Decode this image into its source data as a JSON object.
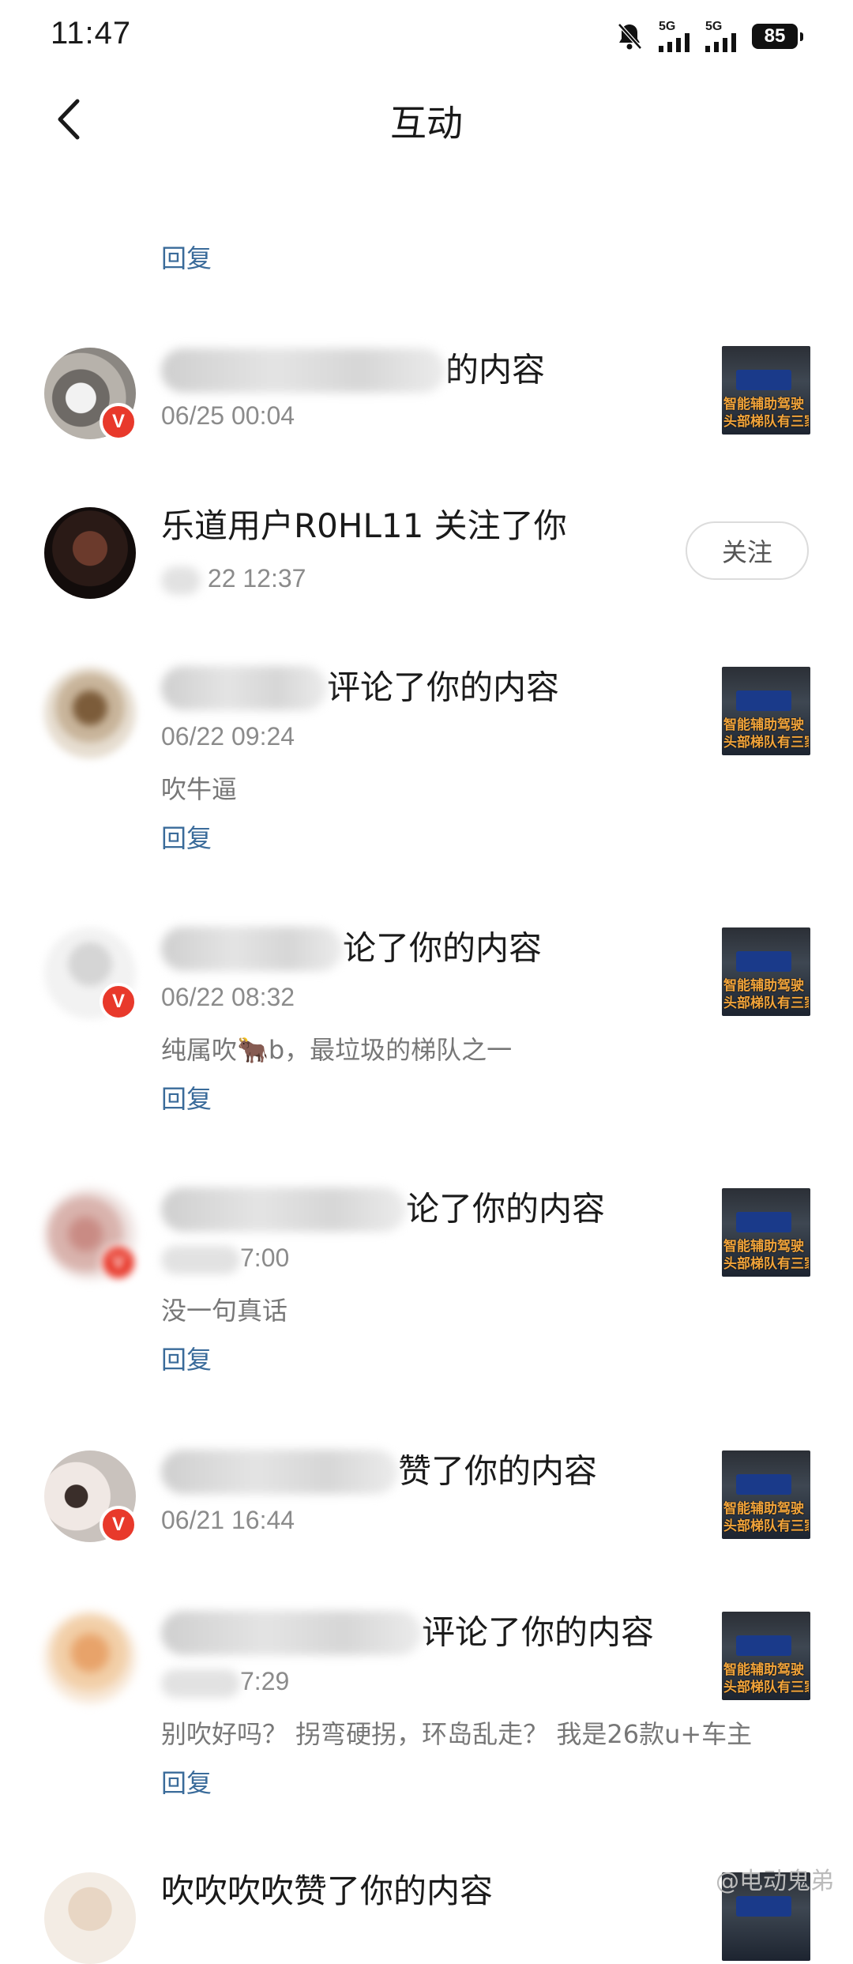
{
  "status_bar": {
    "time": "11:47",
    "network_1": "5G",
    "network_2": "5G",
    "battery": "85",
    "icons": [
      "bell-muted-icon",
      "signal-icon",
      "signal-icon",
      "battery-icon"
    ]
  },
  "nav": {
    "title": "互动",
    "back_icon": "chevron-left-icon"
  },
  "reply_label": "回复",
  "follow_label": "关注",
  "thumbnail_caption": [
    "智能辅助驾驶",
    "头部梯队有三家"
  ],
  "items": [
    {
      "type": "partial-top",
      "reply": "回复"
    },
    {
      "type": "content",
      "title_suffix": "的内容",
      "time": "06/25 00:04",
      "verified": true
    },
    {
      "type": "follow",
      "title": "乐道用户R0HL11 关注了你",
      "time": "22 12:37"
    },
    {
      "type": "comment",
      "title_suffix": "评论了你的内容",
      "time": "06/22 09:24",
      "comment": "吹牛逼",
      "reply": "回复",
      "verified": true
    },
    {
      "type": "comment",
      "title_suffix": "论了你的内容",
      "time": "06/22 08:32",
      "comment": "纯属吹🐂b，最垃圾的梯队之一",
      "reply": "回复",
      "verified": true
    },
    {
      "type": "comment",
      "title_suffix": "论了你的内容",
      "time": "7:00",
      "comment": "没一句真话",
      "reply": "回复",
      "verified": true
    },
    {
      "type": "like",
      "title_suffix": "赞了你的内容",
      "time": "06/21 16:44",
      "verified": true
    },
    {
      "type": "comment",
      "title_suffix": "评论了你的内容",
      "time": "7:29",
      "comment": "别吹好吗？ 拐弯硬拐，环岛乱走？ 我是26款u+车主",
      "reply": "回复"
    },
    {
      "type": "like",
      "title": "吹吹吹吹赞了你的内容"
    }
  ],
  "watermark": "@电动鬼弟"
}
